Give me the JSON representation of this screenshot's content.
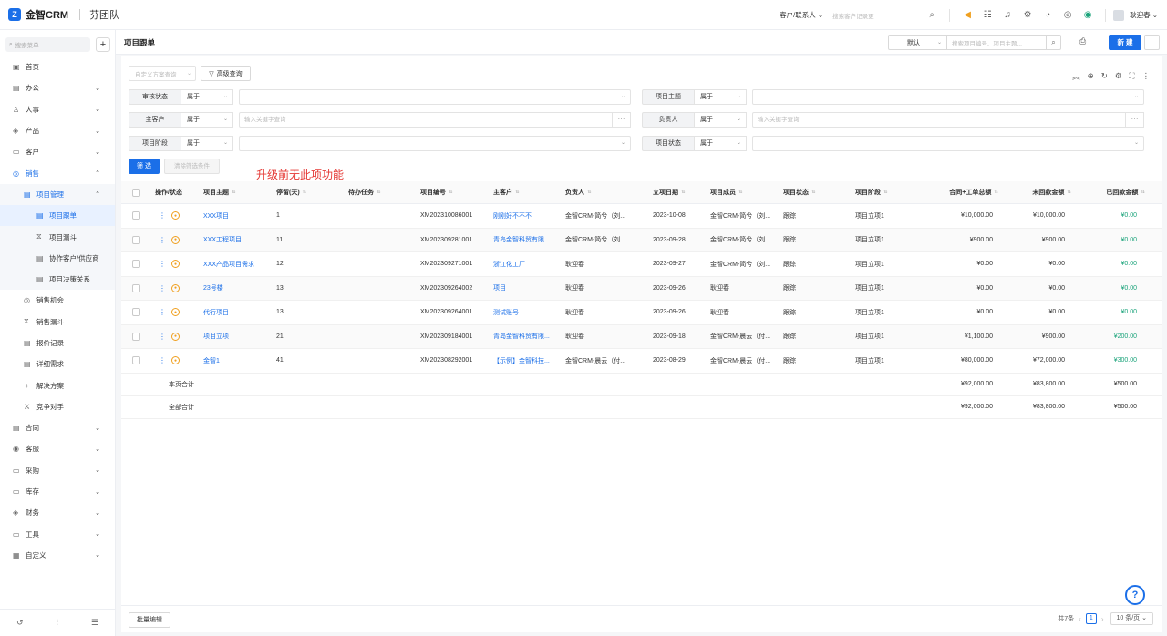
{
  "app": {
    "name": "金智CRM",
    "team": "芬团队",
    "logo_letter": "Z",
    "accent": "#1b6fe8"
  },
  "topbar": {
    "scope": "客户/联系人 ⌄",
    "search_placeholder": "搜索客户记录更",
    "user_name": "耿迎春 ⌄",
    "icons": [
      "search-icon",
      "speaker-icon",
      "contacts-icon",
      "bell-icon",
      "settings-icon",
      "clock-icon",
      "target-icon",
      "notification-badge-icon"
    ]
  },
  "sidebar": {
    "search_placeholder": "搜索菜单",
    "add": "+",
    "items": [
      {
        "label": "首页",
        "icon": "▣",
        "chev": ""
      },
      {
        "label": "办公",
        "icon": "▤",
        "chev": "⌄"
      },
      {
        "label": "人事",
        "icon": "♙",
        "chev": "⌄"
      },
      {
        "label": "产品",
        "icon": "◈",
        "chev": "⌄"
      },
      {
        "label": "客户",
        "icon": "▭",
        "chev": "⌄"
      },
      {
        "label": "销售",
        "icon": "◎",
        "chev": "⌃"
      },
      {
        "label": "项目管理",
        "icon": "▤",
        "chev": "⌃"
      },
      {
        "label": "项目跟单",
        "icon": "▤",
        "chev": ""
      },
      {
        "label": "项目漏斗",
        "icon": "⧖",
        "chev": ""
      },
      {
        "label": "协作客户/供应商",
        "icon": "▤",
        "chev": ""
      },
      {
        "label": "项目决策关系",
        "icon": "▤",
        "chev": ""
      },
      {
        "label": "销售机会",
        "icon": "◎",
        "chev": ""
      },
      {
        "label": "销售漏斗",
        "icon": "⧖",
        "chev": ""
      },
      {
        "label": "报价记录",
        "icon": "▤",
        "chev": ""
      },
      {
        "label": "详细需求",
        "icon": "▤",
        "chev": ""
      },
      {
        "label": "解决方案",
        "icon": "♀",
        "chev": ""
      },
      {
        "label": "竞争对手",
        "icon": "⚔",
        "chev": ""
      },
      {
        "label": "合同",
        "icon": "▤",
        "chev": "⌄"
      },
      {
        "label": "客服",
        "icon": "◉",
        "chev": "⌄"
      },
      {
        "label": "采购",
        "icon": "▭",
        "chev": "⌄"
      },
      {
        "label": "库存",
        "icon": "▭",
        "chev": "⌄"
      },
      {
        "label": "财务",
        "icon": "◈",
        "chev": "⌄"
      },
      {
        "label": "工具",
        "icon": "▭",
        "chev": "⌄"
      },
      {
        "label": "自定义",
        "icon": "▦",
        "chev": "⌄"
      }
    ],
    "bottom_icons": [
      "history-icon",
      "sliders-icon",
      "collapse-menu-icon"
    ]
  },
  "header": {
    "title": "项目跟单",
    "view": "默认",
    "search_placeholder": "搜索项目编号、项目主题...",
    "new_label": "新 建",
    "more": "⋮"
  },
  "filters": {
    "scheme_placeholder": "自定义方案查询",
    "advanced_label": "高级查询",
    "rows": [
      {
        "label": "审核状态",
        "op": "属于",
        "placeholder": ""
      },
      {
        "label": "项目主题",
        "op": "属于",
        "placeholder": ""
      },
      {
        "label": "主客户",
        "op": "属于",
        "placeholder": "输入关键字查询"
      },
      {
        "label": "负责人",
        "op": "属于",
        "placeholder": "输入关键字查询"
      },
      {
        "label": "项目阶段",
        "op": "属于",
        "placeholder": ""
      },
      {
        "label": "项目状态",
        "op": "属于",
        "placeholder": ""
      }
    ],
    "filter_btn": "筛 选",
    "clear_btn": "清除筛选条件",
    "annotation": "升级前无此项功能"
  },
  "table": {
    "columns": [
      "操作/状态",
      "项目主题",
      "停留(天)",
      "待办任务",
      "项目编号",
      "主客户",
      "负责人",
      "立项日期",
      "项目成员",
      "项目状态",
      "项目阶段",
      "合同+工单总额",
      "未回款金额",
      "已回款金额"
    ],
    "rows": [
      {
        "subject": "XXX项目",
        "days": "1",
        "todo": "",
        "code": "XM202310086001",
        "customer": "刚刚好不不不",
        "owner": "金智CRM-简兮（刘...",
        "date": "2023-10-08",
        "members": "金智CRM-简兮（刘...",
        "status": "跟踪",
        "stage": "项目立项1",
        "total": "¥10,000.00",
        "unpaid": "¥10,000.00",
        "paid": "¥0.00"
      },
      {
        "subject": "XXX工程项目",
        "days": "11",
        "todo": "",
        "code": "XM202309281001",
        "customer": "青岛金智科贸有限...",
        "owner": "金智CRM-简兮（刘...",
        "date": "2023-09-28",
        "members": "金智CRM-简兮（刘...",
        "status": "跟踪",
        "stage": "项目立项1",
        "total": "¥900.00",
        "unpaid": "¥900.00",
        "paid": "¥0.00"
      },
      {
        "subject": "XXX产品项目需求",
        "days": "12",
        "todo": "",
        "code": "XM202309271001",
        "customer": "浙江化工厂",
        "owner": "耿迎春",
        "date": "2023-09-27",
        "members": "金智CRM-简兮（刘...",
        "status": "跟踪",
        "stage": "项目立项1",
        "total": "¥0.00",
        "unpaid": "¥0.00",
        "paid": "¥0.00"
      },
      {
        "subject": "23号楼",
        "days": "13",
        "todo": "",
        "code": "XM202309264002",
        "customer": "项目",
        "owner": "耿迎春",
        "date": "2023-09-26",
        "members": "耿迎春",
        "status": "跟踪",
        "stage": "项目立项1",
        "total": "¥0.00",
        "unpaid": "¥0.00",
        "paid": "¥0.00"
      },
      {
        "subject": "代行项目",
        "days": "13",
        "todo": "",
        "code": "XM202309264001",
        "customer": "测试账号",
        "owner": "耿迎春",
        "date": "2023-09-26",
        "members": "耿迎春",
        "status": "跟踪",
        "stage": "项目立项1",
        "total": "¥0.00",
        "unpaid": "¥0.00",
        "paid": "¥0.00"
      },
      {
        "subject": "项目立项",
        "days": "21",
        "todo": "",
        "code": "XM202309184001",
        "customer": "青岛金智科贸有限...",
        "owner": "耿迎春",
        "date": "2023-09-18",
        "members": "金智CRM-晨云（付...",
        "status": "跟踪",
        "stage": "项目立项1",
        "total": "¥1,100.00",
        "unpaid": "¥900.00",
        "paid": "¥200.00"
      },
      {
        "subject": "金智1",
        "days": "41",
        "todo": "",
        "code": "XM202308292001",
        "customer": "【示例】金智科技...",
        "owner": "金智CRM-晨云（付...",
        "date": "2023-08-29",
        "members": "金智CRM-晨云（付...",
        "status": "跟踪",
        "stage": "项目立项1",
        "total": "¥80,000.00",
        "unpaid": "¥72,000.00",
        "paid": "¥300.00"
      }
    ],
    "summaries": [
      {
        "label": "本页合计",
        "total": "¥92,000.00",
        "unpaid": "¥83,800.00",
        "paid": "¥500.00"
      },
      {
        "label": "全部合计",
        "total": "¥92,000.00",
        "unpaid": "¥83,800.00",
        "paid": "¥500.00"
      }
    ]
  },
  "footer": {
    "batch_edit": "批量编辑",
    "total_text": "共7条",
    "page": "1",
    "page_size": "10 条/页 ⌄"
  },
  "help": "?"
}
